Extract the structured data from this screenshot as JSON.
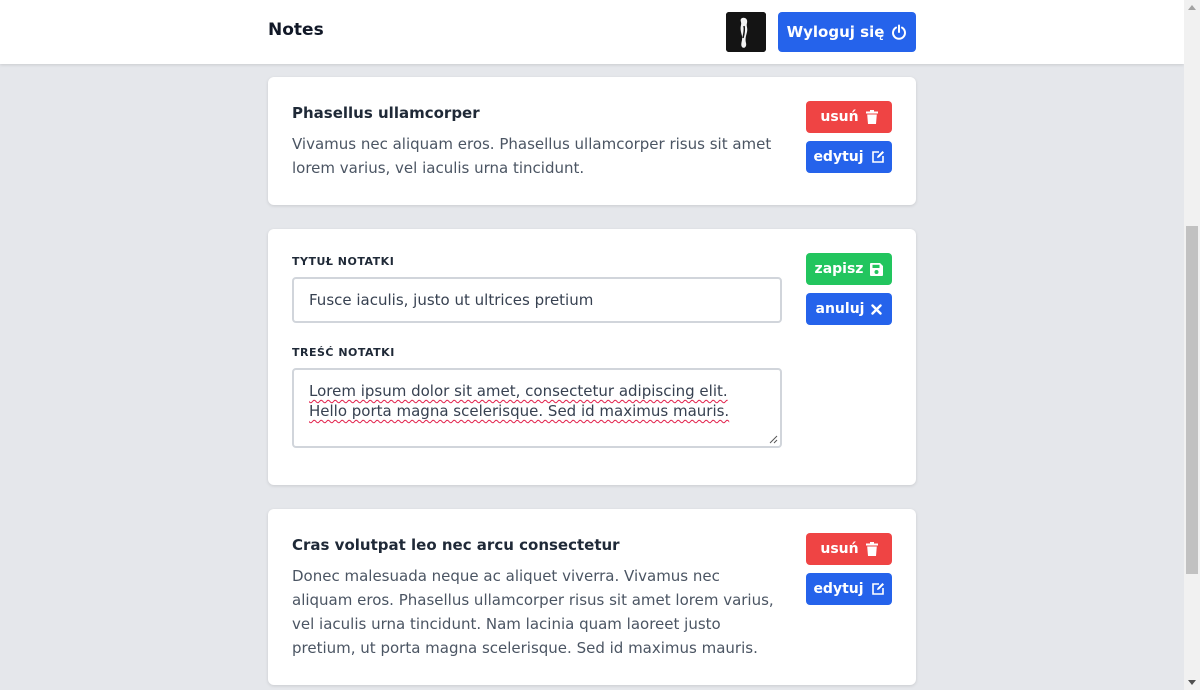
{
  "header": {
    "brand": "Notes",
    "logout_label": "Wyloguj się"
  },
  "notes": [
    {
      "title": "Phasellus ullamcorper",
      "body": "Vivamus nec aliquam eros. Phasellus ullamcorper risus sit amet lorem varius, vel iaculis urna tincidunt.",
      "delete_label": "usuń",
      "edit_label": "edytuj"
    },
    {
      "editing": true,
      "title_field_label": "TYTUŁ NOTATKI",
      "title_value": "Fusce iaculis, justo ut ultrices pretium",
      "content_field_label": "TREŚĆ NOTATKI",
      "content_value": "Lorem ipsum dolor sit amet, consectetur adipiscing elit. Hello porta magna scelerisque. Sed id maximus mauris.",
      "save_label": "zapisz",
      "cancel_label": "anuluj"
    },
    {
      "title": "Cras volutpat leo nec arcu consectetur",
      "body": "Donec malesuada neque ac aliquet viverra. Vivamus nec aliquam eros. Phasellus ullamcorper risus sit amet lorem varius, vel iaculis urna tincidunt. Nam lacinia quam laoreet justo pretium, ut porta magna scelerisque. Sed id maximus mauris.",
      "delete_label": "usuń",
      "edit_label": "edytuj"
    }
  ],
  "icons": {
    "logout": "power-icon",
    "delete": "trash-icon",
    "edit": "edit-icon",
    "save": "save-icon",
    "cancel": "close-icon"
  },
  "colors": {
    "primary": "#2563eb",
    "danger": "#ef4444",
    "success": "#22c55e",
    "background": "#e5e7eb"
  }
}
